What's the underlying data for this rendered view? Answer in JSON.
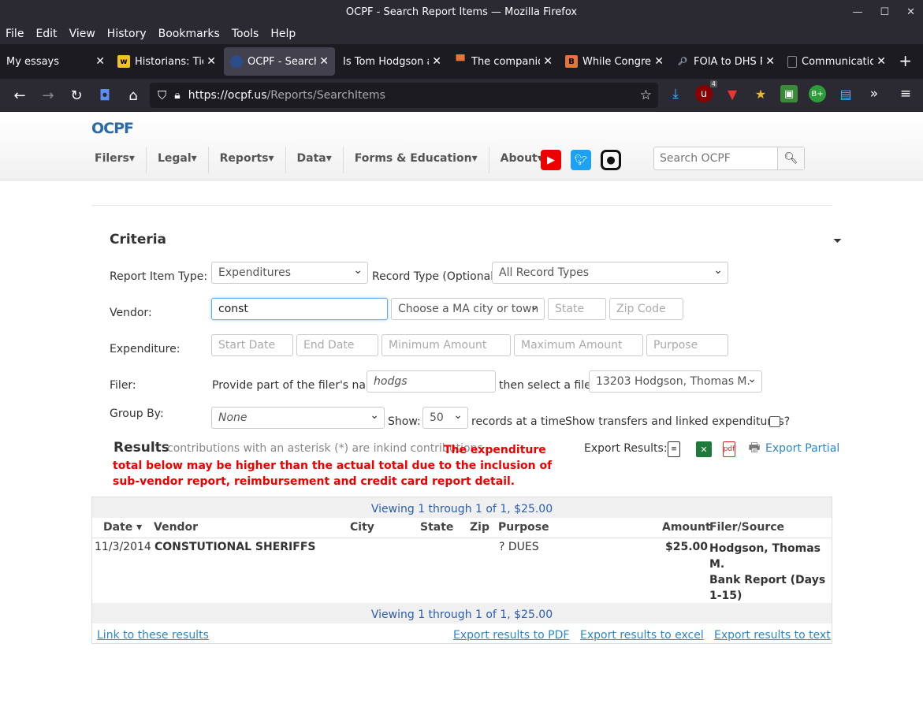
{
  "window": {
    "title": "OCPF - Search Report Items — Mozilla Firefox"
  },
  "menu": [
    "File",
    "Edit",
    "View",
    "History",
    "Bookmarks",
    "Tools",
    "Help"
  ],
  "tabs": [
    {
      "label": "My essays",
      "icon": "doc-icon",
      "icon_color": "#1c1b22"
    },
    {
      "label": "Historians: Tie",
      "icon": "news-icon",
      "icon_color": "#f0c419"
    },
    {
      "label": "OCPF - Search",
      "icon": "ocpf-icon",
      "icon_color": "#2b4d8c"
    },
    {
      "label": "Is Tom Hodgson a",
      "icon": "blank-icon",
      "icon_color": "#1c1b22"
    },
    {
      "label": "The companio",
      "icon": "bookmark-icon",
      "icon_color": "#e8733a"
    },
    {
      "label": "While Congres",
      "icon": "b-icon",
      "icon_color": "#e8733a"
    },
    {
      "label": "FOIA to DHS R",
      "icon": "magnifier-icon",
      "icon_color": "#1c1b22"
    },
    {
      "label": "Communicatio",
      "icon": "doc-icon",
      "icon_color": "#1c1b22"
    }
  ],
  "url": {
    "host": "https://ocpf.us",
    "path": "/Reports/SearchItems"
  },
  "ext_badge": "4",
  "site": {
    "logo_a": "OCPF",
    "nav": [
      "Filers",
      "Legal",
      "Reports",
      "Data",
      "Forms & Education",
      "About"
    ],
    "search_placeholder": "Search OCPF"
  },
  "criteria": {
    "heading": "Criteria",
    "report_item_type_label": "Report Item Type:",
    "report_item_type_value": "Expenditures",
    "record_type_label": "Record Type (Optional):",
    "record_type_value": "All Record Types",
    "vendor_label": "Vendor:",
    "vendor_value": "const",
    "city_value": "Choose a MA city or town",
    "state_placeholder": "State",
    "zip_placeholder": "Zip Code",
    "expenditure_label": "Expenditure:",
    "start_date_placeholder": "Start Date",
    "end_date_placeholder": "End Date",
    "min_amount_placeholder": "Minimum Amount",
    "max_amount_placeholder": "Maximum Amount",
    "purpose_placeholder": "Purpose",
    "filer_label": "Filer:",
    "filer_prompt": "Provide part of the filer's name:",
    "filer_name_value": "hodgs",
    "filer_select_prompt": "then select a filer:",
    "filer_select_value": "13203 Hodgson, Thomas M.",
    "group_by_label": "Group By:",
    "group_by_value": "None",
    "show_label": "Show:",
    "show_value": "50",
    "records_label": "records at a time",
    "transfers_label": "Show transfers and linked expenditures?"
  },
  "results": {
    "heading": "Results",
    "note": "contributions with an asterisk (*) are inkind contributions",
    "warning": "The expenditure total below may be higher than the actual total due to the inclusion of sub-vendor report, reimbursement and credit card report detail.",
    "export_label": "Export Results:",
    "export_partial": "Export Partial",
    "viewing": "Viewing 1 through 1 of 1, $25.00",
    "columns": [
      "Date",
      "Vendor",
      "City",
      "State",
      "Zip",
      "Purpose",
      "Amount",
      "Filer/Source"
    ],
    "rows": [
      {
        "date": "11/3/2014",
        "vendor": "CONSTUTIONAL SHERIFFS",
        "city": "",
        "state": "",
        "zip": "",
        "purpose": "? DUES",
        "amount": "$25.00",
        "filer": "Hodgson, Thomas M.",
        "source": "Bank Report (Days 1-15)"
      }
    ],
    "footer_links": {
      "link": "Link to these results",
      "pdf": "Export results to PDF",
      "excel": "Export results to excel",
      "text": "Export results to text"
    }
  }
}
